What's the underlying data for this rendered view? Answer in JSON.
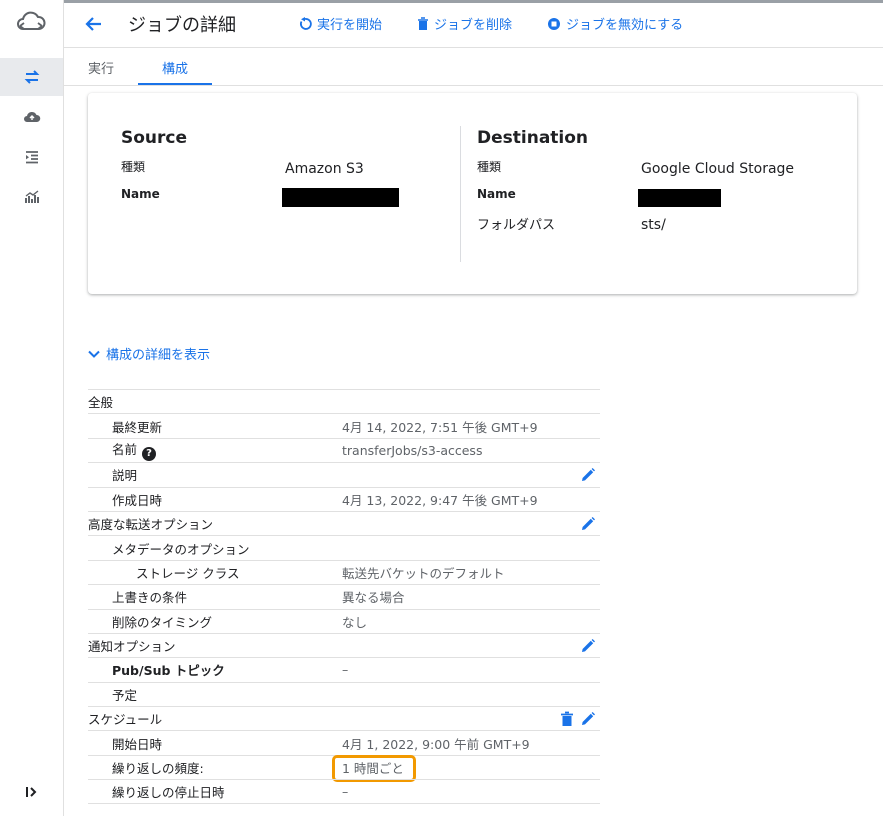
{
  "header": {
    "title": "ジョブの詳細",
    "actions": [
      {
        "label": "実行を開始",
        "icon": "restart-icon"
      },
      {
        "label": "ジョブを削除",
        "icon": "trash-icon"
      },
      {
        "label": "ジョブを無効にする",
        "icon": "disable-icon"
      }
    ]
  },
  "tabs": [
    {
      "label": "実行"
    },
    {
      "label": "構成"
    }
  ],
  "source": {
    "heading": "Source",
    "type_label": "種類",
    "type_value": "Amazon S3",
    "name_label": "Name"
  },
  "destination": {
    "heading": "Destination",
    "type_label": "種類",
    "type_value": "Google Cloud Storage",
    "name_label": "Name",
    "folder_label": "フォルダパス",
    "folder_value": "sts/"
  },
  "expander": {
    "label": "構成の詳細を表示"
  },
  "details": [
    {
      "key": "全般",
      "level": 0,
      "value": ""
    },
    {
      "key": "最終更新",
      "level": 1,
      "value": "4月 14, 2022, 7:51 午後 GMT+9"
    },
    {
      "key": "名前",
      "level": 1,
      "value": "transferJobs/s3-access",
      "help": "?"
    },
    {
      "key": "説明",
      "level": 1,
      "value": "",
      "edit": true
    },
    {
      "key": "作成日時",
      "level": 1,
      "value": "4月 13, 2022, 9:47 午後 GMT+9"
    },
    {
      "key": "高度な転送オプション",
      "level": 0,
      "value": "",
      "edit": true
    },
    {
      "key": "メタデータのオプション",
      "level": 1,
      "value": ""
    },
    {
      "key": "ストレージ クラス",
      "level": 2,
      "value": "転送先バケットのデフォルト"
    },
    {
      "key": "上書きの条件",
      "level": 1,
      "value": "異なる場合"
    },
    {
      "key": "削除のタイミング",
      "level": 1,
      "value": "なし"
    },
    {
      "key": "通知オプション",
      "level": 0,
      "value": "",
      "edit": true
    },
    {
      "key": "Pub/Sub トピック",
      "level": 1,
      "value": "–",
      "bold": true
    },
    {
      "key": "予定",
      "level": 1,
      "value": ""
    },
    {
      "key": "スケジュール",
      "level": 0,
      "value": "",
      "edit": true,
      "delete": true
    },
    {
      "key": "開始日時",
      "level": 1,
      "value": "4月 1, 2022, 9:00 午前 GMT+9"
    },
    {
      "key": "繰り返しの頻度:",
      "level": 1,
      "value": "1 時間ごと",
      "highlight": true
    },
    {
      "key": "繰り返しの停止日時",
      "level": 1,
      "value": "–"
    }
  ],
  "colors": {
    "accent": "#1a73e8",
    "highlight": "#f29900"
  }
}
